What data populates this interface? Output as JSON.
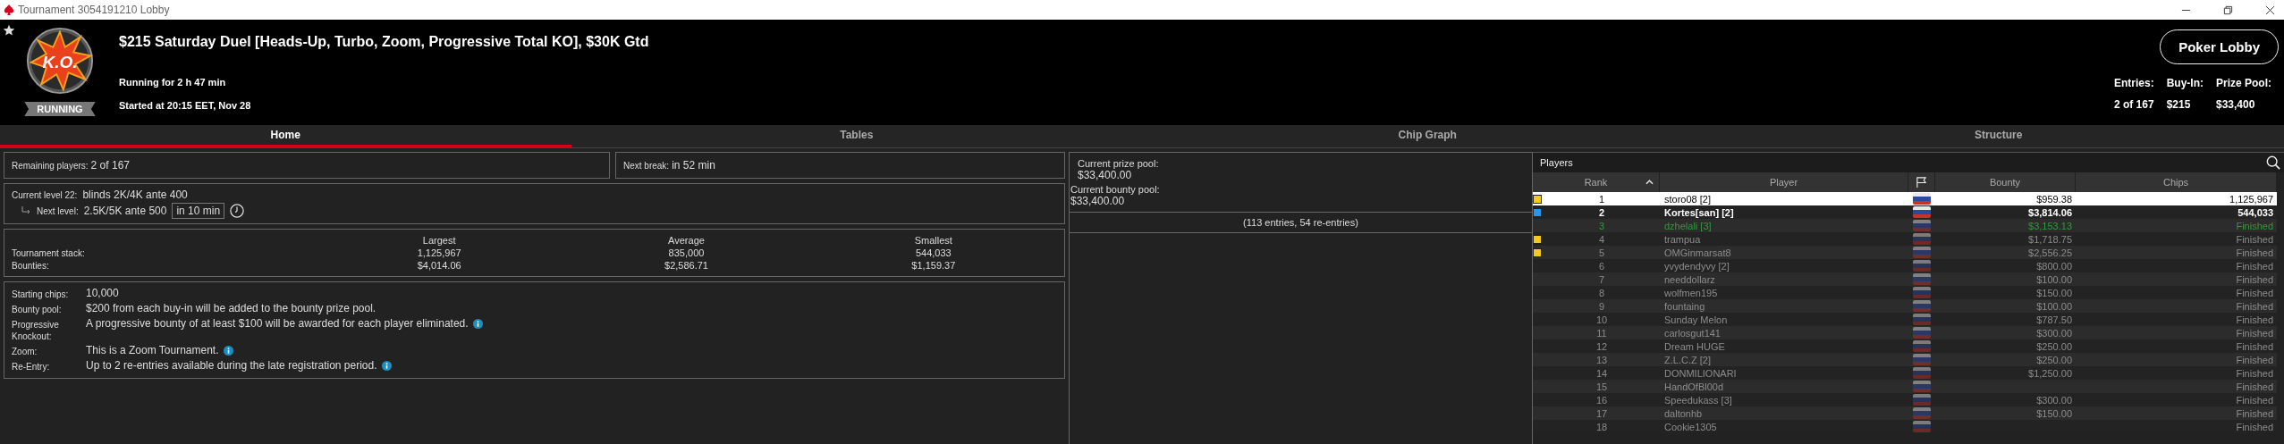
{
  "window": {
    "title": "Tournament 3054191210 Lobby"
  },
  "header": {
    "logo_text": "K.O.",
    "status_badge": "RUNNING",
    "title": "$215 Saturday Duel [Heads-Up, Turbo, Zoom, Progressive Total KO], $30K Gtd",
    "running_for": "Running for 2 h 47 min",
    "started_at": "Started at 20:15 EET, Nov 28",
    "lobby_button": "Poker Lobby",
    "stats": [
      {
        "label": "Entries:",
        "value": "2 of 167"
      },
      {
        "label": "Buy-In:",
        "value": "$215"
      },
      {
        "label": "Prize Pool:",
        "value": "$33,400"
      }
    ]
  },
  "tabs": [
    {
      "label": "Home",
      "selected": true
    },
    {
      "label": "Tables",
      "selected": false
    },
    {
      "label": "Chip Graph",
      "selected": false
    },
    {
      "label": "Structure",
      "selected": false
    }
  ],
  "summary": [
    {
      "label": "Remaining players:",
      "value": "2 of 167"
    },
    {
      "label": "Next break:",
      "value": "in 52 min"
    }
  ],
  "levels": {
    "current_label": "Current level 22:",
    "current_value": "blinds 2K/4K ante 400",
    "next_label": "Next level:",
    "next_value": "2.5K/5K ante 500",
    "next_in": "in 10 min"
  },
  "stacks": {
    "columns": [
      "Largest",
      "Average",
      "Smallest"
    ],
    "rows": [
      {
        "label": "Tournament stack:",
        "values": [
          "1,125,967",
          "835,000",
          "544,033"
        ]
      },
      {
        "label": "Bounties:",
        "values": [
          "$4,014.06",
          "$2,586.71",
          "$1,159.37"
        ]
      }
    ]
  },
  "details": [
    {
      "label": "Starting chips:",
      "value": "10,000",
      "info": false
    },
    {
      "label": "Bounty pool:",
      "value": "$200 from each buy-in will be added to the bounty prize pool.",
      "info": false
    },
    {
      "label": "Progressive Knockout:",
      "value": "A progressive bounty of at least $100 will be awarded for each player eliminated.",
      "info": true
    },
    {
      "label": "Zoom:",
      "value": "This is a Zoom Tournament.",
      "info": true
    },
    {
      "label": "Re-Entry:",
      "value": "Up to 2 re-entries available during the late registration period.",
      "info": true
    }
  ],
  "pools": {
    "prize_label": "Current prize pool:",
    "prize_value": "$33,400.00",
    "bounty_label": "Current bounty pool:",
    "bounty_value": "$33,400.00",
    "entries_note": "(113 entries, 54 re-entries)"
  },
  "players": {
    "title": "Players",
    "columns": [
      {
        "kind": "rank",
        "label": "Rank"
      },
      {
        "kind": "text",
        "label": "Player"
      },
      {
        "kind": "flag"
      },
      {
        "kind": "number",
        "label": "Bounty"
      },
      {
        "kind": "number",
        "label": "Chips"
      }
    ],
    "rows": [
      {
        "rank": "1",
        "player": "storo08 [2]",
        "bounty": "$959.38",
        "chips": "1,125,967",
        "color": "#f2cb1d",
        "kind": "playing",
        "selected": true
      },
      {
        "rank": "2",
        "player": "Kortes[san] [2]",
        "bounty": "$3,814.06",
        "chips": "544,033",
        "color": "#2196f3",
        "kind": "playing",
        "selected": false
      },
      {
        "rank": "3",
        "player": "dzhelali [3]",
        "bounty": "$3,153.13",
        "chips": "Finished",
        "kind": "runner-up",
        "selected": false
      },
      {
        "rank": "4",
        "player": "trampua",
        "bounty": "$1,718.75",
        "chips": "Finished",
        "color": "#f2cb1d",
        "kind": "finished",
        "selected": false
      },
      {
        "rank": "5",
        "player": "OMGinmarsat8",
        "bounty": "$2,556.25",
        "chips": "Finished",
        "color": "#f2cb1d",
        "kind": "finished",
        "selected": false
      },
      {
        "rank": "6",
        "player": "yvydendyvy [2]",
        "bounty": "$800.00",
        "chips": "Finished",
        "kind": "finished",
        "selected": false
      },
      {
        "rank": "7",
        "player": "needdollarz",
        "bounty": "$100.00",
        "chips": "Finished",
        "kind": "finished",
        "selected": false
      },
      {
        "rank": "8",
        "player": "wolfmen195",
        "bounty": "$150.00",
        "chips": "Finished",
        "kind": "finished",
        "selected": false
      },
      {
        "rank": "9",
        "player": "fountaing",
        "bounty": "$100.00",
        "chips": "Finished",
        "kind": "finished",
        "selected": false
      },
      {
        "rank": "10",
        "player": "Sunday Melon",
        "bounty": "$787.50",
        "chips": "Finished",
        "kind": "finished",
        "selected": false
      },
      {
        "rank": "11",
        "player": "carlosgut141",
        "bounty": "$300.00",
        "chips": "Finished",
        "kind": "finished",
        "selected": false
      },
      {
        "rank": "12",
        "player": "Dream HUGE",
        "bounty": "$250.00",
        "chips": "Finished",
        "kind": "finished",
        "selected": false
      },
      {
        "rank": "13",
        "player": "Z.L.C.Z [2]",
        "bounty": "$250.00",
        "chips": "Finished",
        "kind": "finished",
        "selected": false
      },
      {
        "rank": "14",
        "player": "DONMILIONARI",
        "bounty": "$1,250.00",
        "chips": "Finished",
        "kind": "finished",
        "selected": false
      },
      {
        "rank": "15",
        "player": "HandOfBl00d",
        "chips": "Finished",
        "kind": "finished",
        "selected": false
      },
      {
        "rank": "16",
        "player": "Speedukass [3]",
        "bounty": "$300.00",
        "chips": "Finished",
        "kind": "finished",
        "selected": false
      },
      {
        "rank": "17",
        "player": "daltonhb",
        "bounty": "$150.00",
        "chips": "Finished",
        "kind": "finished",
        "selected": false
      },
      {
        "rank": "18",
        "player": "Cookie1305",
        "chips": "Finished",
        "kind": "finished",
        "selected": false
      }
    ]
  }
}
